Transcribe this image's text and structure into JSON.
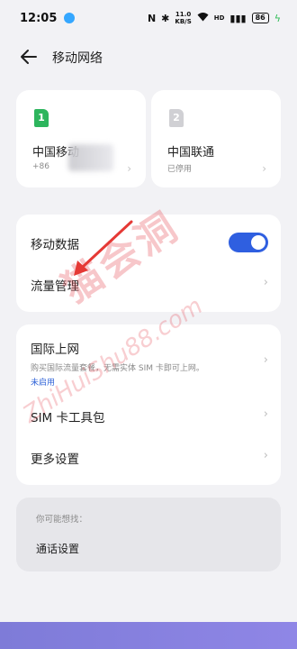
{
  "status_bar": {
    "time": "12:05",
    "nfc": "N",
    "bluetooth": "✱",
    "speed_value": "11.0",
    "speed_unit": "KB/S",
    "hd": "HD",
    "signal": "▮▮▮",
    "battery": "86",
    "charging": "ϟ"
  },
  "header": {
    "back_icon": "arrow-left-icon",
    "title": "移动网络"
  },
  "sims": [
    {
      "slot": "1",
      "name": "中国移动",
      "sub": "+86",
      "color": "#2db55d"
    },
    {
      "slot": "2",
      "name": "中国联通",
      "sub": "已停用",
      "color": "#d0d0d4"
    }
  ],
  "card_a": {
    "mobile_data": "移动数据",
    "mobile_data_enabled": true,
    "traffic_management": "流量管理"
  },
  "card_b": {
    "international": "国际上网",
    "international_desc": "购买国际流量套餐，无需实体 SIM 卡即可上网。",
    "international_status": "未启用",
    "sim_toolkit": "SIM 卡工具包",
    "more_settings": "更多设置"
  },
  "suggest": {
    "title": "你可能想找：",
    "link": "通话设置"
  },
  "watermark": {
    "main": "猫会洞",
    "sub": "ZhiHuiShu88.com"
  },
  "colors": {
    "accent": "#2f5fe0",
    "arrow": "#e53935",
    "background": "#f2f2f5"
  }
}
